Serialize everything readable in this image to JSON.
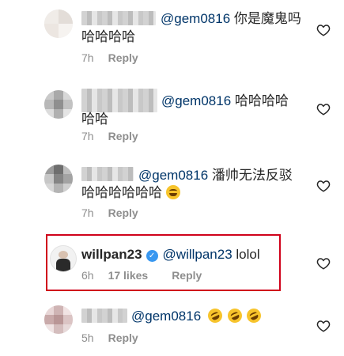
{
  "comments": [
    {
      "mention": "@gem0816",
      "line1": " 你是魔鬼吗",
      "line2": "哈哈哈哈",
      "time": "7h",
      "reply_label": "Reply"
    },
    {
      "mention": "@gem0816",
      "line1": " 哈哈哈哈",
      "line2": "哈哈",
      "time": "7h",
      "reply_label": "Reply"
    },
    {
      "mention": "@gem0816",
      "line1": " 潘帅无法反驳",
      "line2": "哈哈哈哈哈哈",
      "time": "7h",
      "reply_label": "Reply",
      "emoji": "face-with-tears-of-joy"
    },
    {
      "username": "willpan23",
      "verified": true,
      "mention": "@willpan23",
      "line1": " lolol",
      "time": "6h",
      "likes": "17 likes",
      "reply_label": "Reply",
      "highlight_color": "#d0021b"
    },
    {
      "mention": "@gem0816",
      "emoji": "rolling-on-floor-laughing",
      "emoji_count": 3,
      "time": "5h",
      "reply_label": "Reply"
    }
  ],
  "colors": {
    "text": "#262626",
    "mention": "#003569",
    "meta": "#8e8e8e",
    "verified": "#3897f0",
    "highlight_border": "#d0021b"
  },
  "icons": {
    "like": "heart-outline-icon",
    "verified": "verified-badge-icon"
  }
}
